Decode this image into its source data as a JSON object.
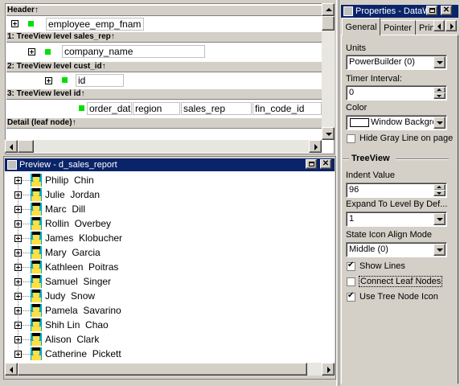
{
  "design": {
    "bands": [
      "Header↑",
      "1: TreeView level sales_rep↑",
      "2: TreeView level cust_id↑",
      "3: TreeView level id↑",
      "Detail (leaf node)↑"
    ],
    "header_field": "employee_emp_fnam",
    "level1_field": "company_name",
    "level2_field": "id",
    "level3_fields": [
      "order_dat",
      "region",
      "sales_rep",
      "fin_code_id"
    ]
  },
  "preview": {
    "title": "Preview - d_sales_report",
    "people": [
      "Philip  Chin",
      "Julie  Jordan",
      "Marc  Dill",
      "Rollin  Overbey",
      "James  Klobucher",
      "Mary  Garcia",
      "Kathleen  Poitras",
      "Samuel  Singer",
      "Judy  Snow",
      "Pamela  Savarino",
      "Shih Lin  Chao",
      "Alison  Clark",
      "Catherine  Pickett"
    ]
  },
  "properties": {
    "title": "Properties - DataW",
    "tabs": [
      "General",
      "Pointer",
      "Prin"
    ],
    "units_label": "Units",
    "units_value": "PowerBuilder (0)",
    "timer_label": "Timer Interval:",
    "timer_value": "0",
    "color_label": "Color",
    "color_value": "Window Backgro",
    "color_swatch": "#ffffff",
    "hide_gray_label": "Hide Gray Line on page",
    "treeview_section": "TreeView",
    "indent_label": "Indent Value",
    "indent_value": "96",
    "expand_label": "Expand To Level By Def...",
    "expand_value": "1",
    "state_label": "State Icon Align Mode",
    "state_value": "Middle (0)",
    "show_lines_label": "Show Lines",
    "connect_leaf_label": "Connect Leaf Nodes",
    "use_tree_icon_label": "Use Tree Node Icon"
  },
  "colors": {
    "titlebar": "#0a246a",
    "face": "#d4d0c8",
    "level_marker": "#00e000"
  }
}
